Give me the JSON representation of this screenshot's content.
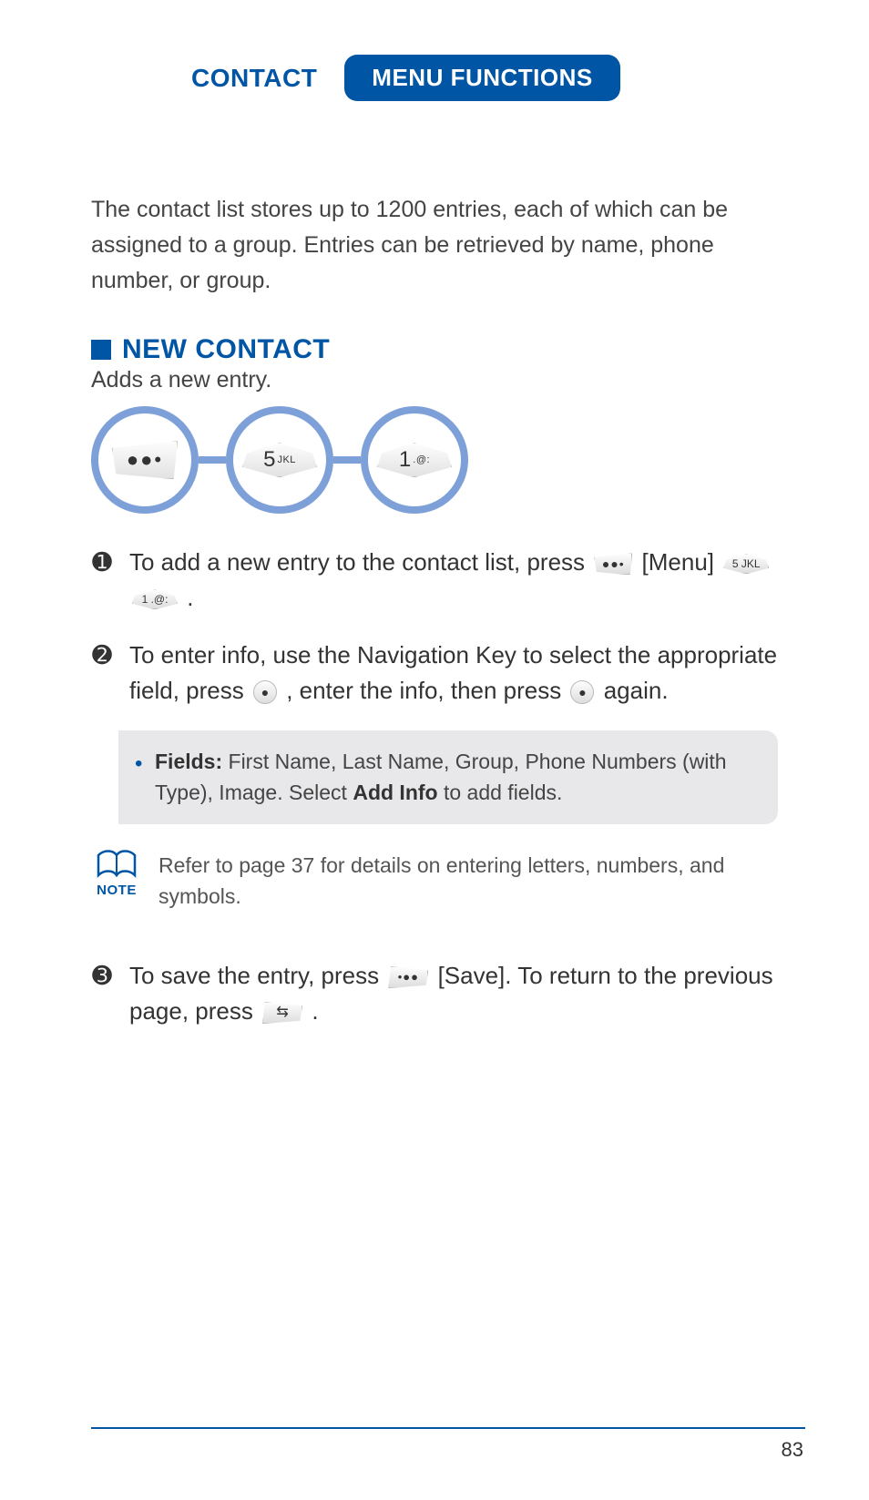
{
  "header": {
    "left": "CONTACT",
    "tab": "MENU FUNCTIONS"
  },
  "intro": "The contact list stores up to 1200 entries, each of which can be assigned to a group. Entries can be retrieved by name, phone number, or group.",
  "section": {
    "title": "NEW CONTACT",
    "subtitle": "Adds a new entry."
  },
  "keyrow": {
    "menu_dots": "●●•",
    "key5_big": "5",
    "key5_small": "JKL",
    "key1_big": "1",
    "key1_small": ".@:"
  },
  "steps": {
    "s1": {
      "num": "➊",
      "pre": "To add a new entry to the contact list, press ",
      "menu_dots": "●●•",
      "after_menu_label": " [Menu] ",
      "k5": "5 JKL",
      "k1": "1 .@:",
      "end": " ."
    },
    "s2": {
      "num": "➋",
      "pre": "To enter info, use the Navigation Key to select the appropriate field, press ",
      "ok1": "●",
      "mid": " , enter the info, then press ",
      "ok2": "●",
      "end": " again."
    },
    "fields": {
      "label": "Fields:",
      "text1": " First Name, Last Name, Group, Phone Numbers (with Type), Image. Select ",
      "addinfo": "Add Info",
      "text2": " to add fields."
    },
    "note": {
      "label": "NOTE",
      "text": "Refer to page 37 for details on entering letters, numbers, and symbols."
    },
    "s3": {
      "num": "➌",
      "pre": "To save the entry, press ",
      "save_dots": "•●●",
      "save_label": " [Save]. To return to the previous page, press ",
      "back_glyph": "⇆",
      "end": " ."
    }
  },
  "page_number": "83"
}
